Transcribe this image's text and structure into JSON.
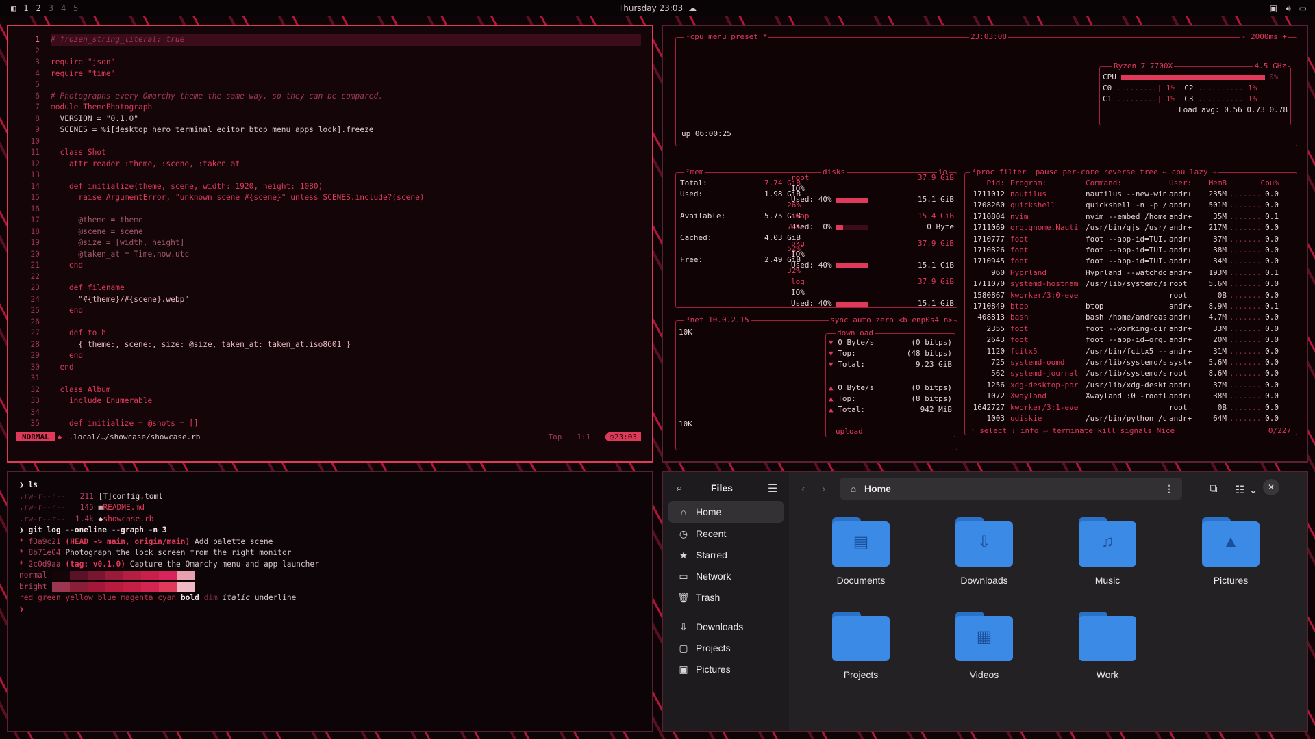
{
  "topbar": {
    "workspaces": [
      "1",
      "2",
      "3",
      "4",
      "5"
    ],
    "clock": "Thursday 23:03",
    "tray": [
      "screen-icon",
      "volume-icon",
      "display-icon"
    ]
  },
  "editor": {
    "lines": [
      {
        "n": "1",
        "t": "# frozen_string_literal: true"
      },
      {
        "n": "2",
        "t": ""
      },
      {
        "n": "3",
        "t": "require \"json\""
      },
      {
        "n": "4",
        "t": "require \"time\""
      },
      {
        "n": "5",
        "t": ""
      },
      {
        "n": "6",
        "t": "# Photographs every Omarchy theme the same way, so they can be compared."
      },
      {
        "n": "7",
        "t": "module ThemePhotograph"
      },
      {
        "n": "8",
        "t": "  VERSION = \"0.1.0\""
      },
      {
        "n": "9",
        "t": "  SCENES = %i[desktop hero terminal editor btop menu apps lock].freeze"
      },
      {
        "n": "10",
        "t": ""
      },
      {
        "n": "11",
        "t": "  class Shot"
      },
      {
        "n": "12",
        "t": "    attr_reader :theme, :scene, :taken_at"
      },
      {
        "n": "13",
        "t": ""
      },
      {
        "n": "14",
        "t": "    def initialize(theme, scene, width: 1920, height: 1080)"
      },
      {
        "n": "15",
        "t": "      raise ArgumentError, \"unknown scene #{scene}\" unless SCENES.include?(scene)"
      },
      {
        "n": "16",
        "t": ""
      },
      {
        "n": "17",
        "t": "      @theme = theme"
      },
      {
        "n": "18",
        "t": "      @scene = scene"
      },
      {
        "n": "19",
        "t": "      @size = [width, height]"
      },
      {
        "n": "20",
        "t": "      @taken_at = Time.now.utc"
      },
      {
        "n": "21",
        "t": "    end"
      },
      {
        "n": "22",
        "t": ""
      },
      {
        "n": "23",
        "t": "    def filename"
      },
      {
        "n": "24",
        "t": "      \"#{theme}/#{scene}.webp\""
      },
      {
        "n": "25",
        "t": "    end"
      },
      {
        "n": "26",
        "t": ""
      },
      {
        "n": "27",
        "t": "    def to_h"
      },
      {
        "n": "28",
        "t": "      { theme:, scene:, size: @size, taken_at: taken_at.iso8601 }"
      },
      {
        "n": "29",
        "t": "    end"
      },
      {
        "n": "30",
        "t": "  end"
      },
      {
        "n": "31",
        "t": ""
      },
      {
        "n": "32",
        "t": "  class Album"
      },
      {
        "n": "33",
        "t": "    include Enumerable"
      },
      {
        "n": "34",
        "t": ""
      },
      {
        "n": "35",
        "t": "    def initialize = @shots = []"
      }
    ],
    "status": {
      "mode": "NORMAL",
      "path": ".local/…/showcase/showcase.rb",
      "position": "Top",
      "cursor": "1:1",
      "time": "23:03"
    }
  },
  "btop": {
    "cpu": {
      "title": "¹cpu",
      "menu": "menu",
      "preset": "preset *",
      "time": "23:03:08",
      "rate": "- 2000ms +",
      "model": "Ryzen 7 7700X",
      "freq": "4.5 GHz",
      "cpu_pct": "0%",
      "c0": "1%",
      "c1": "1%",
      "c2": "1%",
      "c3": "1%",
      "load": "Load avg: 0.56 0.73 0.78",
      "uptime": "up 06:00:25"
    },
    "mem": {
      "title": "²mem",
      "total_label": "Total:",
      "total": "7.74 GiB",
      "used_label": "Used:",
      "used": "1.98 GiB",
      "used_pct": "26%",
      "avail_label": "Available:",
      "avail": "5.75 GiB",
      "avail_pct": "74%",
      "cached_label": "Cached:",
      "cached": "4.03 GiB",
      "cached_pct": "52%",
      "free_label": "Free:",
      "free": "2.49 GiB",
      "free_pct": "32%"
    },
    "disks": {
      "title": "disks",
      "io": "io",
      "items": [
        {
          "name": "root",
          "size": "37.9 GiB",
          "io": "IO%",
          "used": "Used: 40%",
          "val": "15.1 GiB"
        },
        {
          "name": "swap",
          "size": "15.4 GiB",
          "io": "",
          "used": "Used:  0%",
          "val": "0 Byte"
        },
        {
          "name": "pkg",
          "size": "37.9 GiB",
          "io": "IO%",
          "used": "Used: 40%",
          "val": "15.1 GiB"
        },
        {
          "name": "log",
          "size": "37.9 GiB",
          "io": "IO%",
          "used": "Used: 40%",
          "val": "15.1 GiB"
        }
      ]
    },
    "net": {
      "title": "³net",
      "ip": "10.0.2.15",
      "sync": "sync",
      "auto": "auto",
      "zero": "zero",
      "iface": "<b enp0s4 n>",
      "scale_top": "10K",
      "scale_bot": "10K",
      "download_label": "download",
      "dl_rate": "0 Byte/s",
      "dl_bits": "(0 bitps)",
      "dl_top": "Top:",
      "dl_top_val": "(48 bitps)",
      "dl_total": "Total:",
      "dl_total_val": "9.23 GiB",
      "ul_rate": "0 Byte/s",
      "ul_bits": "(0 bitps)",
      "ul_top": "Top:",
      "ul_top_val": "(8 bitps)",
      "ul_total": "Total:",
      "ul_total_val": "942 MiB",
      "upload_label": "upload"
    },
    "proc": {
      "title": "⁴proc",
      "filter": "filter",
      "pause": "pause",
      "percore": "per-core",
      "reverse": "reverse",
      "tree": "tree",
      "sort": "← cpu lazy →",
      "header": {
        "pid": "Pid:",
        "prog": "Program:",
        "cmd": "Command:",
        "user": "User:",
        "mem": "MemB",
        "cpu": "Cpu%"
      },
      "rows": [
        [
          "1711012",
          "nautilus",
          "nautilus --new-win",
          "andr+",
          "235M",
          "0.0"
        ],
        [
          "1708260",
          "quickshell",
          "quickshell -n -p /",
          "andr+",
          "501M",
          "0.0"
        ],
        [
          "1710804",
          "nvim",
          "nvim --embed /home",
          "andr+",
          "35M",
          "0.1"
        ],
        [
          "1711069",
          "org.gnome.Nauti",
          "/usr/bin/gjs /usr/",
          "andr+",
          "217M",
          "0.0"
        ],
        [
          "1710777",
          "foot",
          "foot --app-id=TUI.",
          "andr+",
          "37M",
          "0.0"
        ],
        [
          "1710826",
          "foot",
          "foot --app-id=TUI.",
          "andr+",
          "38M",
          "0.0"
        ],
        [
          "1710945",
          "foot",
          "foot --app-id=TUI.",
          "andr+",
          "34M",
          "0.0"
        ],
        [
          "960",
          "Hyprland",
          "Hyprland --watchdo",
          "andr+",
          "193M",
          "0.1"
        ],
        [
          "1711070",
          "systemd-hostnam",
          "/usr/lib/systemd/s",
          "root",
          "5.6M",
          "0.0"
        ],
        [
          "1580867",
          "kworker/3:0-even",
          "",
          "root",
          "0B",
          "0.0"
        ],
        [
          "1710849",
          "btop",
          "btop",
          "andr+",
          "8.9M",
          "0.1"
        ],
        [
          "408813",
          "bash",
          "bash /home/andreas",
          "andr+",
          "4.7M",
          "0.0"
        ],
        [
          "2355",
          "foot",
          "foot --working-dir",
          "andr+",
          "33M",
          "0.0"
        ],
        [
          "2643",
          "foot",
          "foot --app-id=org.",
          "andr+",
          "20M",
          "0.0"
        ],
        [
          "1120",
          "fcitx5",
          "/usr/bin/fcitx5 --",
          "andr+",
          "31M",
          "0.0"
        ],
        [
          "725",
          "systemd-oomd",
          "/usr/lib/systemd/s",
          "syst+",
          "5.6M",
          "0.0"
        ],
        [
          "562",
          "systemd-journal",
          "/usr/lib/systemd/s",
          "root",
          "8.6M",
          "0.0"
        ],
        [
          "1256",
          "xdg-desktop-por",
          "/usr/lib/xdg-deskt",
          "andr+",
          "37M",
          "0.0"
        ],
        [
          "1072",
          "Xwayland",
          "Xwayland :0 -rootl",
          "andr+",
          "38M",
          "0.0"
        ],
        [
          "1642727",
          "kworker/3:1-even",
          "",
          "root",
          "0B",
          "0.0"
        ],
        [
          "1003",
          "udiskie",
          "/usr/bin/python /u",
          "andr+",
          "64M",
          "0.0"
        ]
      ],
      "footer": {
        "select": "↑ select ↓",
        "info": "info ↵",
        "terminate": "terminate",
        "kill": "kill",
        "signals": "signals",
        "nice": "Nice",
        "count": "0/227"
      }
    }
  },
  "terminal": {
    "lines": [
      {
        "k": "prompt",
        "t": "❯ ls"
      },
      {
        "k": "ls",
        "perm": ".rw-r--r--",
        "size": "211",
        "icon": "[T]",
        "name": "config.toml"
      },
      {
        "k": "ls",
        "perm": ".rw-r--r--",
        "size": "145",
        "icon": "▦",
        "name": "README.md"
      },
      {
        "k": "ls",
        "perm": ".rw-r--r--",
        "size": "1.4k",
        "icon": "◆",
        "name": "showcase.rb"
      },
      {
        "k": "prompt",
        "t": "❯ git log --oneline --graph -n 3"
      },
      {
        "k": "git",
        "hash": "f3a9c21",
        "ref": "(HEAD -> main, origin/main)",
        "msg": "Add palette scene"
      },
      {
        "k": "git",
        "hash": "8b71e04",
        "ref": "",
        "msg": "Photograph the lock screen from the right monitor"
      },
      {
        "k": "git",
        "hash": "2c0d9aa",
        "ref": "(tag: v0.1.0)",
        "msg": "Capture the Omarchy menu and app launcher"
      }
    ],
    "normal_label": "normal",
    "bright_label": "bright",
    "palette_normal": [
      "#140509",
      "#5a1027",
      "#7a1530",
      "#9a1a3a",
      "#b51d42",
      "#c8204a",
      "#d8245a",
      "#e6a0b0"
    ],
    "palette_bright": [
      "#9c3550",
      "#8a1d38",
      "#a3183a",
      "#b81b40",
      "#c51f48",
      "#d22552",
      "#e03a5a",
      "#f0b8c4"
    ],
    "styles": [
      "red",
      "green",
      "yellow",
      "blue",
      "magenta",
      "cyan",
      "bold",
      "dim",
      "italic",
      "underline"
    ],
    "last_prompt": "❯"
  },
  "files": {
    "title": "Files",
    "sidebar": [
      {
        "label": "Home",
        "icon": "home-icon"
      },
      {
        "label": "Recent",
        "icon": "clock-icon"
      },
      {
        "label": "Starred",
        "icon": "star-icon"
      },
      {
        "label": "Network",
        "icon": "network-icon"
      },
      {
        "label": "Trash",
        "icon": "trash-icon"
      },
      {
        "label": "Downloads",
        "icon": "download-icon"
      },
      {
        "label": "Projects",
        "icon": "folder-icon"
      },
      {
        "label": "Pictures",
        "icon": "picture-icon"
      }
    ],
    "location": "Home",
    "folders": [
      {
        "label": "Documents",
        "glyph": "▤"
      },
      {
        "label": "Downloads",
        "glyph": "⇩"
      },
      {
        "label": "Music",
        "glyph": "♫"
      },
      {
        "label": "Pictures",
        "glyph": "▲"
      },
      {
        "label": "Projects",
        "glyph": ""
      },
      {
        "label": "Videos",
        "glyph": "▦"
      },
      {
        "label": "Work",
        "glyph": ""
      }
    ]
  }
}
